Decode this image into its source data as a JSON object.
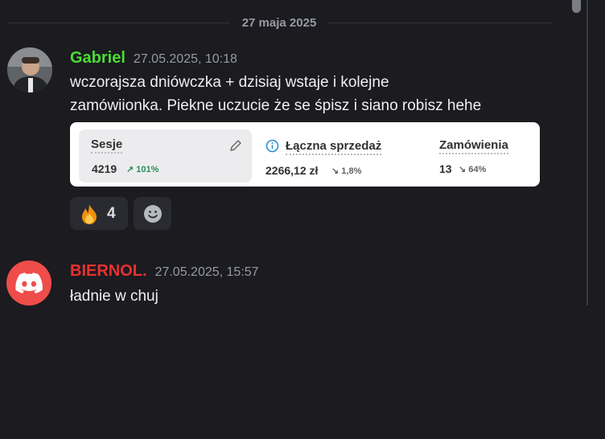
{
  "date_divider": "27 maja 2025",
  "messages": [
    {
      "author": "Gabriel",
      "author_color": "#4ade33",
      "timestamp": "27.05.2025, 10:18",
      "lines": [
        "wczorajsza dniówczka + dzisiaj wstaje i kolejne",
        "zamówiionka. Piekne uczucie że se śpisz i siano robisz hehe"
      ],
      "embed": {
        "stats": [
          {
            "title": "Sesje",
            "value": "4219",
            "delta": "↗ 101%",
            "delta_dir": "up"
          },
          {
            "title": "Łączna sprzedaż",
            "value": "2266,12 zł",
            "delta": "↘ 1,8%",
            "delta_dir": "down"
          },
          {
            "title": "Zamówienia",
            "value": "13",
            "delta": "↘ 64%",
            "delta_dir": "down"
          }
        ]
      },
      "reactions": [
        {
          "emoji": "fire-emoji",
          "count": "4"
        },
        {
          "emoji": "add-reaction-icon",
          "count": ""
        }
      ]
    },
    {
      "author": "BIERNOL.",
      "author_color": "#e8312e",
      "timestamp": "27.05.2025, 15:57",
      "lines": [
        "ładnie w chuj"
      ]
    }
  ]
}
